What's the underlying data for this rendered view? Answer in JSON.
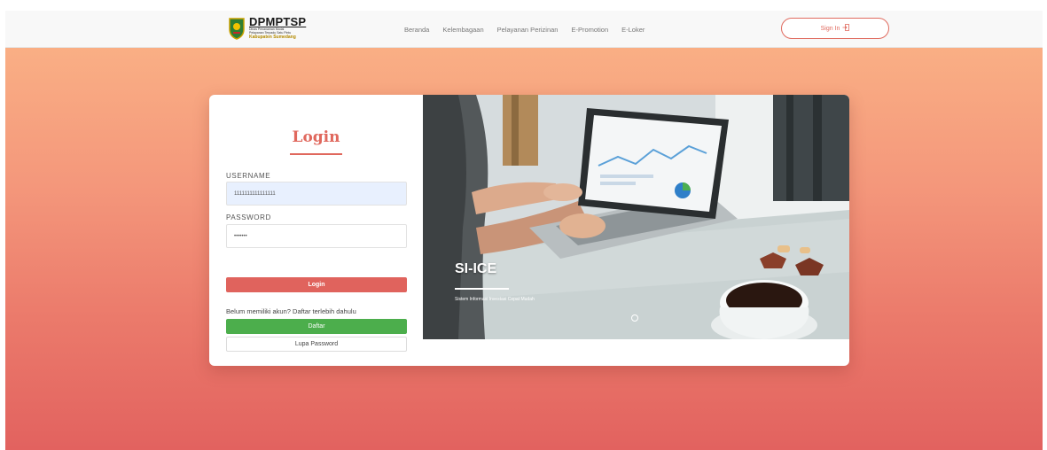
{
  "navbar": {
    "logo": {
      "title": "DPMPTSP",
      "subtitle_line1": "Dinas Penanaman Modal",
      "subtitle_line2": "Pelayanan Terpadu Satu Pintu",
      "region": "Kabupaten Sumedang"
    },
    "links": [
      "Beranda",
      "Kelembagaan",
      "Pelayanan Perizinan",
      "E-Promotion",
      "E-Loker"
    ],
    "signin_label": "Sign In",
    "signin_icon": "sign-in-icon"
  },
  "login": {
    "title": "Login",
    "username_label": "USERNAME",
    "username_value": "1111111111111111",
    "password_label": "PASSWORD",
    "password_value": "•••••••",
    "login_button": "Login",
    "register_prompt": "Belum memiliki akun? Daftar terlebih dahulu",
    "register_button": "Daftar",
    "forgot_button": "Lupa Password"
  },
  "slide": {
    "title": "SI-ICE",
    "caption": "Sistem Informasi Investasi Cepat Mudah"
  },
  "colors": {
    "accent": "#e0685d",
    "success": "#4cae4c",
    "background_top": "#fbb587",
    "background_bottom": "#e2625f"
  }
}
